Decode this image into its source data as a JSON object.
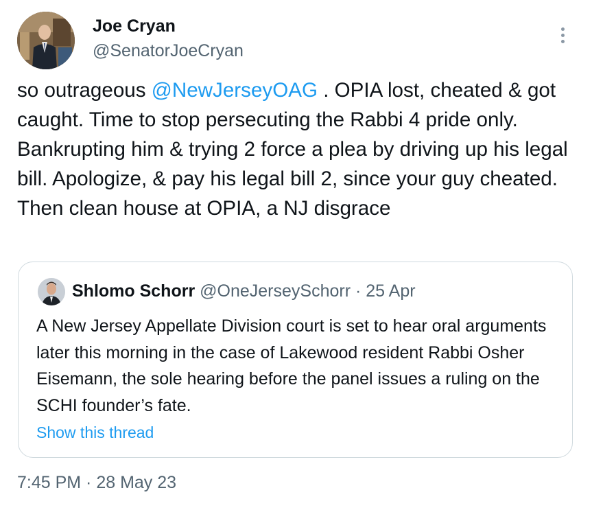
{
  "tweet": {
    "author": {
      "name": "Joe Cryan",
      "handle": "@SenatorJoeCryan",
      "avatar_icon": "profile-photo"
    },
    "text_parts": {
      "before_mention": "so outrageous ",
      "mention": "@NewJerseyOAG",
      "after_mention": " . OPIA lost, cheated & got caught. Time to stop persecuting the Rabbi 4 pride only. Bankrupting him & trying 2 force a plea by driving up his legal bill. Apologize, & pay his legal bill 2, since your guy cheated. Then clean house at OPIA, a NJ disgrace"
    },
    "timestamp": "7:45 PM · 28 May 23",
    "more_icon": "vertical-ellipsis-icon"
  },
  "quoted": {
    "name": "Shlomo Schorr",
    "handle": "@OneJerseySchorr",
    "separator": " · ",
    "date": "25 Apr",
    "text": "A New Jersey Appellate Division court is set to hear oral arguments later this morning in the case of Lakewood resident Rabbi Osher Eisemann, the sole hearing before the panel issues a ruling on the SCHI founder’s fate.",
    "show_thread": "Show this thread"
  },
  "colors": {
    "link": "#1d9bf0",
    "secondary_text": "#536471",
    "primary_text": "#0f1419",
    "border": "#cfd9de"
  }
}
